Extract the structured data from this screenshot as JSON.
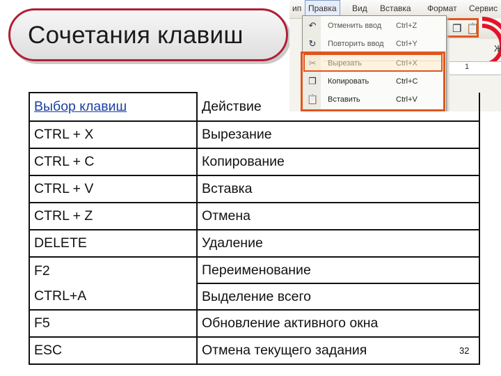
{
  "slide": {
    "title": "Сочетания клавиш",
    "page_number": "32"
  },
  "menu_screenshot": {
    "menubar": [
      "ип",
      "Правка",
      "Вид",
      "Вставка",
      "Формат",
      "Сервис"
    ],
    "active_menu": "Правка",
    "items": [
      {
        "icon": "undo-icon",
        "label": "Отменить ввод",
        "shortcut": "Ctrl+Z"
      },
      {
        "icon": "redo-icon",
        "label": "Повторить ввод",
        "shortcut": "Ctrl+Y"
      },
      {
        "icon": "scissors-icon",
        "label": "Вырезать",
        "shortcut": "Ctrl+X"
      },
      {
        "icon": "copy-icon",
        "label": "Копировать",
        "shortcut": "Ctrl+C"
      },
      {
        "icon": "paste-icon",
        "label": "Вставить",
        "shortcut": "Ctrl+V"
      }
    ],
    "ruler_marks": [
      "1"
    ],
    "right_edge_glyph": "Ж"
  },
  "table": {
    "header": {
      "key": "Выбор клавиш",
      "action": "Действие"
    },
    "rows": [
      {
        "key": "CTRL + X",
        "action": "Вырезание"
      },
      {
        "key": "CTRL + C",
        "action": "Копирование"
      },
      {
        "key": "CTRL + V",
        "action": "Вставка"
      },
      {
        "key": "CTRL + Z",
        "action": "Отмена"
      },
      {
        "key": "DELETE",
        "action": "Удаление"
      },
      {
        "key": "F2",
        "action": "Переименование"
      },
      {
        "key": "CTRL+A",
        "action": "Выделение всего"
      },
      {
        "key": "F5",
        "action": "Обновление активного окна"
      },
      {
        "key": "ESC",
        "action": "Отмена текущего задания"
      }
    ]
  },
  "colors": {
    "accent": "#b01f37",
    "highlight": "#e0561e",
    "link": "#1a3fa4"
  }
}
